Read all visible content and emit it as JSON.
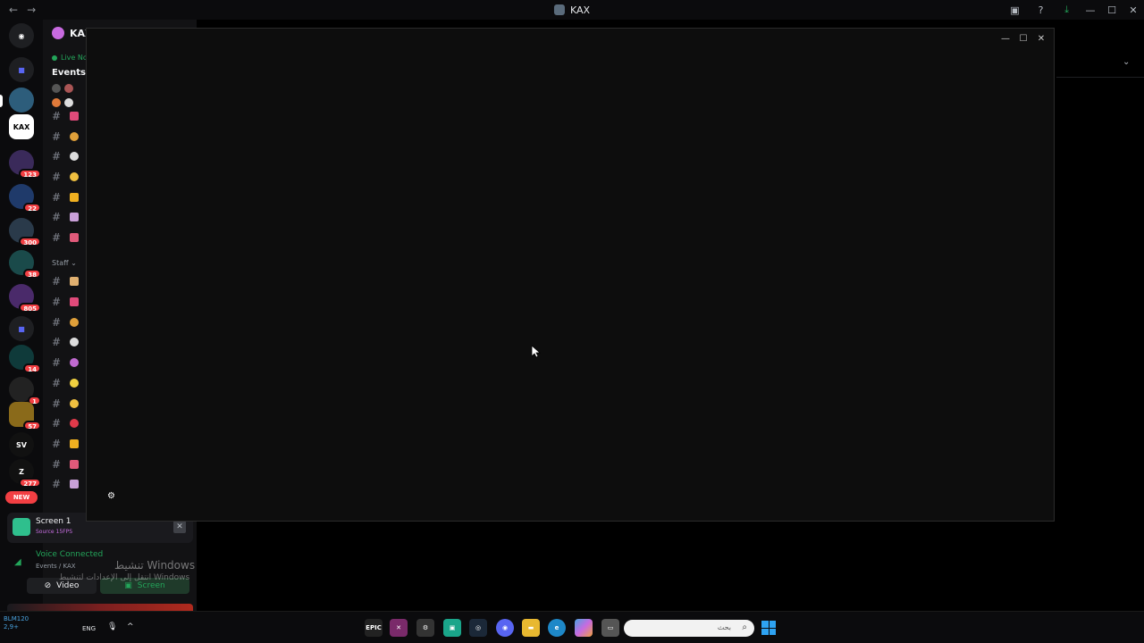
{
  "titlebar": {
    "title": "KAX",
    "nav_back": "←",
    "nav_forward": "→",
    "icons": [
      "inbox-icon",
      "help-icon",
      "download-icon"
    ],
    "minimize": "—",
    "maximize": "☐",
    "close": "✕"
  },
  "rail": {
    "servers": [
      {
        "name": "discord-home",
        "badge": ""
      },
      {
        "name": "folder",
        "badge": ""
      },
      {
        "name": "server-green",
        "badge": ""
      },
      {
        "name": "KAX",
        "label": "KAX",
        "badge": ""
      },
      {
        "name": "server-a",
        "badge": "123"
      },
      {
        "name": "server-b",
        "badge": "22"
      },
      {
        "name": "server-c",
        "badge": "300"
      },
      {
        "name": "server-d",
        "badge": "38"
      },
      {
        "name": "server-e",
        "badge": "805"
      },
      {
        "name": "folder-2",
        "badge": ""
      },
      {
        "name": "server-f",
        "badge": "14"
      },
      {
        "name": "server-g",
        "badge": "1"
      },
      {
        "name": "server-h",
        "badge": "57"
      },
      {
        "name": "server-sv",
        "label": "SV",
        "badge": ""
      },
      {
        "name": "server-z",
        "label": "Z",
        "badge": "277"
      }
    ],
    "new_label": "NEW"
  },
  "sidebar": {
    "server_name": "KAX",
    "live_text": "Live Nov",
    "events_label": "Events",
    "category_staff": "Staff ⌄",
    "hash": "#"
  },
  "screen_panel": {
    "title": "Screen 1",
    "source": "Source 15FPS"
  },
  "voice": {
    "title": "Voice Connected",
    "subtitle": "Events / KAX",
    "video_label": "Video",
    "screen_label": "Screen"
  },
  "watermark": {
    "line1": "تنشيط Windows",
    "line2": "انتقل إلى الإعدادات لتنشيط Windows"
  },
  "popup": {
    "minimize": "—",
    "maximize": "☐",
    "close": "✕"
  },
  "taskbar": {
    "left_line1": "BLM120",
    "left_line2": "2,9+",
    "lang": "ENG",
    "search_placeholder": "بحث",
    "apps": [
      "EPIC",
      "app-x",
      "app-settings",
      "app-green",
      "steam",
      "discord",
      "file-explorer",
      "edge",
      "copilot",
      "app-window"
    ]
  }
}
